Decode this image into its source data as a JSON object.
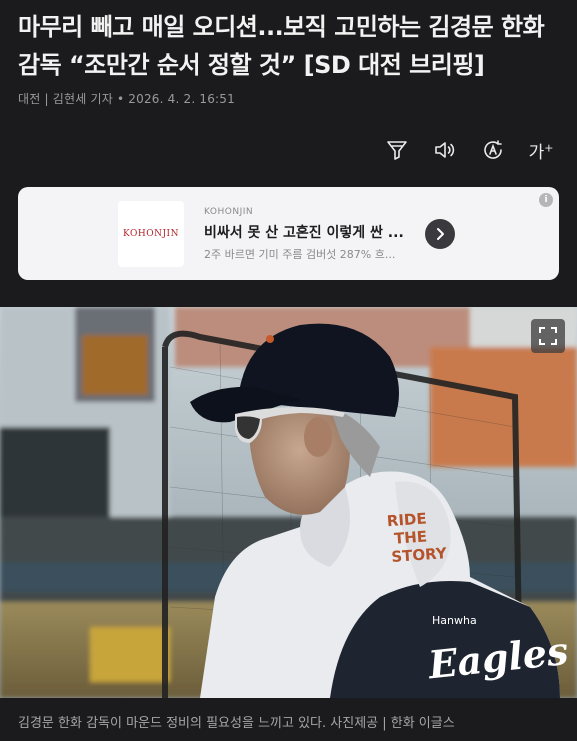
{
  "article": {
    "headline": "마무리 빼고 매일 오디션...보직 고민하는 김경문 한화 감독 “조만간 순서 정할 것” [SD 대전 브리핑]",
    "byline": "대전 | 김현세 기자 • 2026. 4. 2. 16:51"
  },
  "toolbar": {
    "items": [
      {
        "icon": "filter-icon"
      },
      {
        "icon": "speaker-icon"
      },
      {
        "icon": "translate-icon"
      },
      {
        "icon": "font-size-icon",
        "label": "가",
        "sup": "+"
      }
    ]
  },
  "ad": {
    "logo_text": "KOHONJIN",
    "brand": "KOHONJIN",
    "title": "비싸서 못 산 고혼진 이렇게 싼 ...",
    "description": "2주 바르면 기미 주름 검버섯 287% 흐...",
    "info_icon": "info-icon",
    "arrow_icon": "chevron-right-icon"
  },
  "photo": {
    "hood_text": [
      "RIDE",
      "THE",
      "STORY"
    ],
    "team_small": "Hanwha",
    "team_logo": "Eagles",
    "expand_icon": "fullscreen-icon"
  },
  "caption": "김경문 한화 감독이 마운드 정비의 필요성을 느끼고 있다. 사진제공 | 한화 이글스"
}
